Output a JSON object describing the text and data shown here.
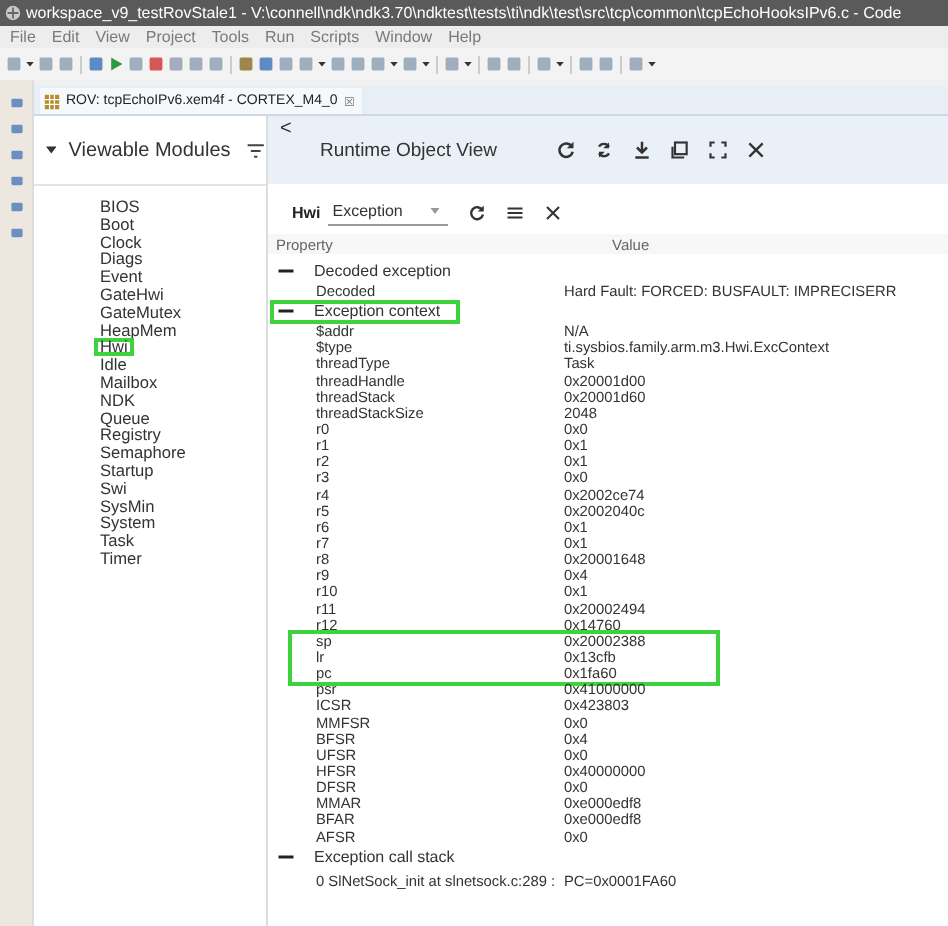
{
  "window": {
    "title": "workspace_v9_testRovStale1 - V:\\connell\\ndk\\ndk3.70\\ndktest\\tests\\ti\\ndk\\test\\src\\tcp\\common\\tcpEchoHooksIPv6.c - Code"
  },
  "menu": [
    "File",
    "Edit",
    "View",
    "Project",
    "Tools",
    "Run",
    "Scripts",
    "Window",
    "Help"
  ],
  "editor_tab": {
    "label": "ROV: tcpEchoIPv6.xem4f - CORTEX_M4_0",
    "close": "☒"
  },
  "modules_panel": {
    "title": "Viewable Modules",
    "items": [
      {
        "label": "BIOS",
        "highlighted": false
      },
      {
        "label": "Boot",
        "highlighted": false
      },
      {
        "label": "Clock",
        "highlighted": false
      },
      {
        "label": "Diags",
        "highlighted": false
      },
      {
        "label": "Event",
        "highlighted": false
      },
      {
        "label": "GateHwi",
        "highlighted": false
      },
      {
        "label": "GateMutex",
        "highlighted": false
      },
      {
        "label": "HeapMem",
        "highlighted": false
      },
      {
        "label": "Hwi",
        "highlighted": true
      },
      {
        "label": "Idle",
        "highlighted": false
      },
      {
        "label": "Mailbox",
        "highlighted": false
      },
      {
        "label": "NDK",
        "highlighted": false
      },
      {
        "label": "Queue",
        "highlighted": false
      },
      {
        "label": "Registry",
        "highlighted": false
      },
      {
        "label": "Semaphore",
        "highlighted": false
      },
      {
        "label": "Startup",
        "highlighted": false
      },
      {
        "label": "Swi",
        "highlighted": false
      },
      {
        "label": "SysMin",
        "highlighted": false
      },
      {
        "label": "System",
        "highlighted": false
      },
      {
        "label": "Task",
        "highlighted": false
      },
      {
        "label": "Timer",
        "highlighted": false
      }
    ]
  },
  "rov": {
    "back": "<",
    "title": "Runtime Object View",
    "module": "Hwi",
    "view": "Exception",
    "columns": [
      "Property",
      "Value"
    ],
    "sections": [
      {
        "label": "Decoded exception",
        "expanded": true,
        "highlighted": false,
        "rows": [
          {
            "property": "Decoded",
            "value": "Hard Fault: FORCED: BUSFAULT: IMPRECISERR",
            "highlighted": false
          }
        ]
      },
      {
        "label": "Exception context",
        "expanded": true,
        "highlighted": true,
        "rows": [
          {
            "property": "$addr",
            "value": "N/A",
            "highlighted": false
          },
          {
            "property": "$type",
            "value": "ti.sysbios.family.arm.m3.Hwi.ExcContext",
            "highlighted": false
          },
          {
            "property": "threadType",
            "value": "Task",
            "highlighted": false
          },
          {
            "property": "threadHandle",
            "value": "0x20001d00",
            "highlighted": false
          },
          {
            "property": "threadStack",
            "value": "0x20001d60",
            "highlighted": false
          },
          {
            "property": "threadStackSize",
            "value": "2048",
            "highlighted": false
          },
          {
            "property": "r0",
            "value": "0x0",
            "highlighted": false
          },
          {
            "property": "r1",
            "value": "0x1",
            "highlighted": false
          },
          {
            "property": "r2",
            "value": "0x1",
            "highlighted": false
          },
          {
            "property": "r3",
            "value": "0x0",
            "highlighted": false
          },
          {
            "property": "r4",
            "value": "0x2002ce74",
            "highlighted": false
          },
          {
            "property": "r5",
            "value": "0x2002040c",
            "highlighted": false
          },
          {
            "property": "r6",
            "value": "0x1",
            "highlighted": false
          },
          {
            "property": "r7",
            "value": "0x1",
            "highlighted": false
          },
          {
            "property": "r8",
            "value": "0x20001648",
            "highlighted": false
          },
          {
            "property": "r9",
            "value": "0x4",
            "highlighted": false
          },
          {
            "property": "r10",
            "value": "0x1",
            "highlighted": false
          },
          {
            "property": "r11",
            "value": "0x20002494",
            "highlighted": false
          },
          {
            "property": "r12",
            "value": "0x14760",
            "highlighted": false
          },
          {
            "property": "sp",
            "value": "0x20002388",
            "highlighted": true
          },
          {
            "property": "lr",
            "value": "0x13cfb",
            "highlighted": true
          },
          {
            "property": "pc",
            "value": "0x1fa60",
            "highlighted": true
          },
          {
            "property": "psr",
            "value": "0x41000000",
            "highlighted": false
          },
          {
            "property": "ICSR",
            "value": "0x423803",
            "highlighted": false
          },
          {
            "property": "MMFSR",
            "value": "0x0",
            "highlighted": false
          },
          {
            "property": "BFSR",
            "value": "0x4",
            "highlighted": false
          },
          {
            "property": "UFSR",
            "value": "0x0",
            "highlighted": false
          },
          {
            "property": "HFSR",
            "value": "0x40000000",
            "highlighted": false
          },
          {
            "property": "DFSR",
            "value": "0x0",
            "highlighted": false
          },
          {
            "property": "MMAR",
            "value": "0xe000edf8",
            "highlighted": false
          },
          {
            "property": "BFAR",
            "value": "0xe000edf8",
            "highlighted": false
          },
          {
            "property": "AFSR",
            "value": "0x0",
            "highlighted": false
          }
        ]
      },
      {
        "label": "Exception call stack",
        "expanded": true,
        "highlighted": false,
        "rows": [
          {
            "property": "0 SlNetSock_init at slnetsock.c:289 :",
            "value": "PC=0x0001FA60",
            "highlighted": false
          }
        ]
      }
    ]
  }
}
